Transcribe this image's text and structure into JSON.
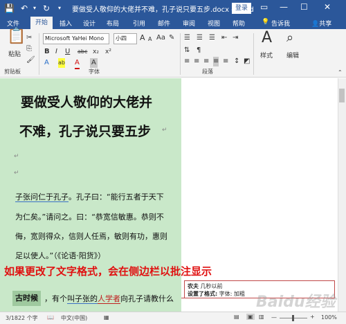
{
  "titlebar": {
    "doc_title": "要做受人敬仰的大佬并不难，孔子说只要五步.docx - Word",
    "login_label": "登录",
    "save_icon": "💾",
    "undo_icon": "↶",
    "redo_icon": "↻",
    "restore_icon": "▭",
    "minimize_icon": "—",
    "maximize_icon": "☐",
    "close_icon": "✕"
  },
  "tabs": {
    "file": "文件",
    "home": "开始",
    "insert": "插入",
    "design": "设计",
    "layout": "布局",
    "references": "引用",
    "mailings": "邮件",
    "review": "审阅",
    "view": "视图",
    "help": "帮助",
    "tellme": "告诉我",
    "share": "共享"
  },
  "ribbon": {
    "paste_label": "粘贴",
    "clipboard_label": "剪贴板",
    "font_group_label": "字体",
    "paragraph_group_label": "段落",
    "styles_label": "样式",
    "edit_label": "编辑",
    "font_name": "Microsoft YaHei Mono",
    "font_size": "小四",
    "bold": "B",
    "italic": "I",
    "underline": "U",
    "strike": "abc",
    "subscript": "x₂",
    "superscript": "x²",
    "font_color": "A",
    "highlight": "ab",
    "char_shade": "A",
    "grow": "A",
    "shrink": "A"
  },
  "document": {
    "title_line1": "要做受人敬仰的大佬并",
    "title_line2": "不难，孔子说只要五步",
    "line1": {
      "a": "子张问仁于孔子",
      "b": "。孔子曰：“能行五者于天下"
    },
    "line2": "为仁矣。”请问之。曰：“恭宽信敏惠。恭则不",
    "line3": "侮，宽则得众，信则人任焉，敏则有功，惠则",
    "line4": "足以使人。”（《论语·阳货》）",
    "annotation": "如果更改了文字格式，会在侧边栏以批注显示",
    "last_line": {
      "bold_word": "古时候",
      "mid1": "，有个",
      "name": "叫子张的",
      "scholar": "人学者",
      "end": "向孔子请教什么"
    }
  },
  "comment": {
    "author": "农夫",
    "time": "几秒以前",
    "line2_label": "设置了格式:",
    "line2_value": "字体: 加粗"
  },
  "status": {
    "pages": "3/1822 个字",
    "language": "中文(中国)",
    "zoom": "100%",
    "zoom_minus": "—",
    "zoom_plus": "+"
  },
  "watermark": "Baidu经验"
}
